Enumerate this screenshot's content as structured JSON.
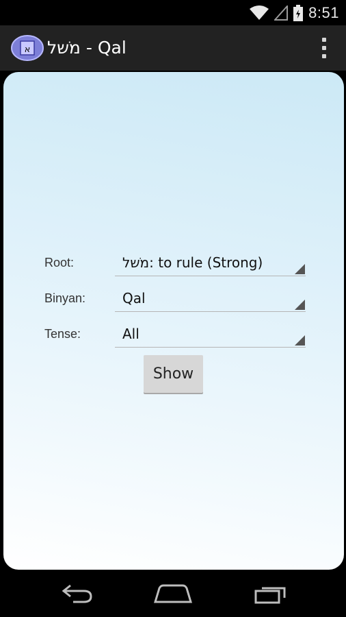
{
  "status_bar": {
    "time": "8:51",
    "icons": [
      "wifi-icon",
      "cell-signal-icon",
      "battery-icon"
    ]
  },
  "action_bar": {
    "title": "מֹשל - Qal",
    "app_icon": "aleph-app-icon",
    "overflow_icon": "overflow-menu-icon"
  },
  "form": {
    "root": {
      "label": "Root:",
      "value": "מֹשל: to rule (Strong)"
    },
    "binyan": {
      "label": "Binyan:",
      "value": "Qal"
    },
    "tense": {
      "label": "Tense:",
      "value": "All"
    },
    "show_button": "Show"
  },
  "nav_bar": {
    "icons": [
      "back-icon",
      "home-icon",
      "recent-apps-icon"
    ]
  },
  "colors": {
    "action_bar_bg": "#222222",
    "panel_gradient_top": "#cce9f6",
    "panel_gradient_bottom": "#ffffff",
    "button_bg": "#d7d7d7"
  }
}
